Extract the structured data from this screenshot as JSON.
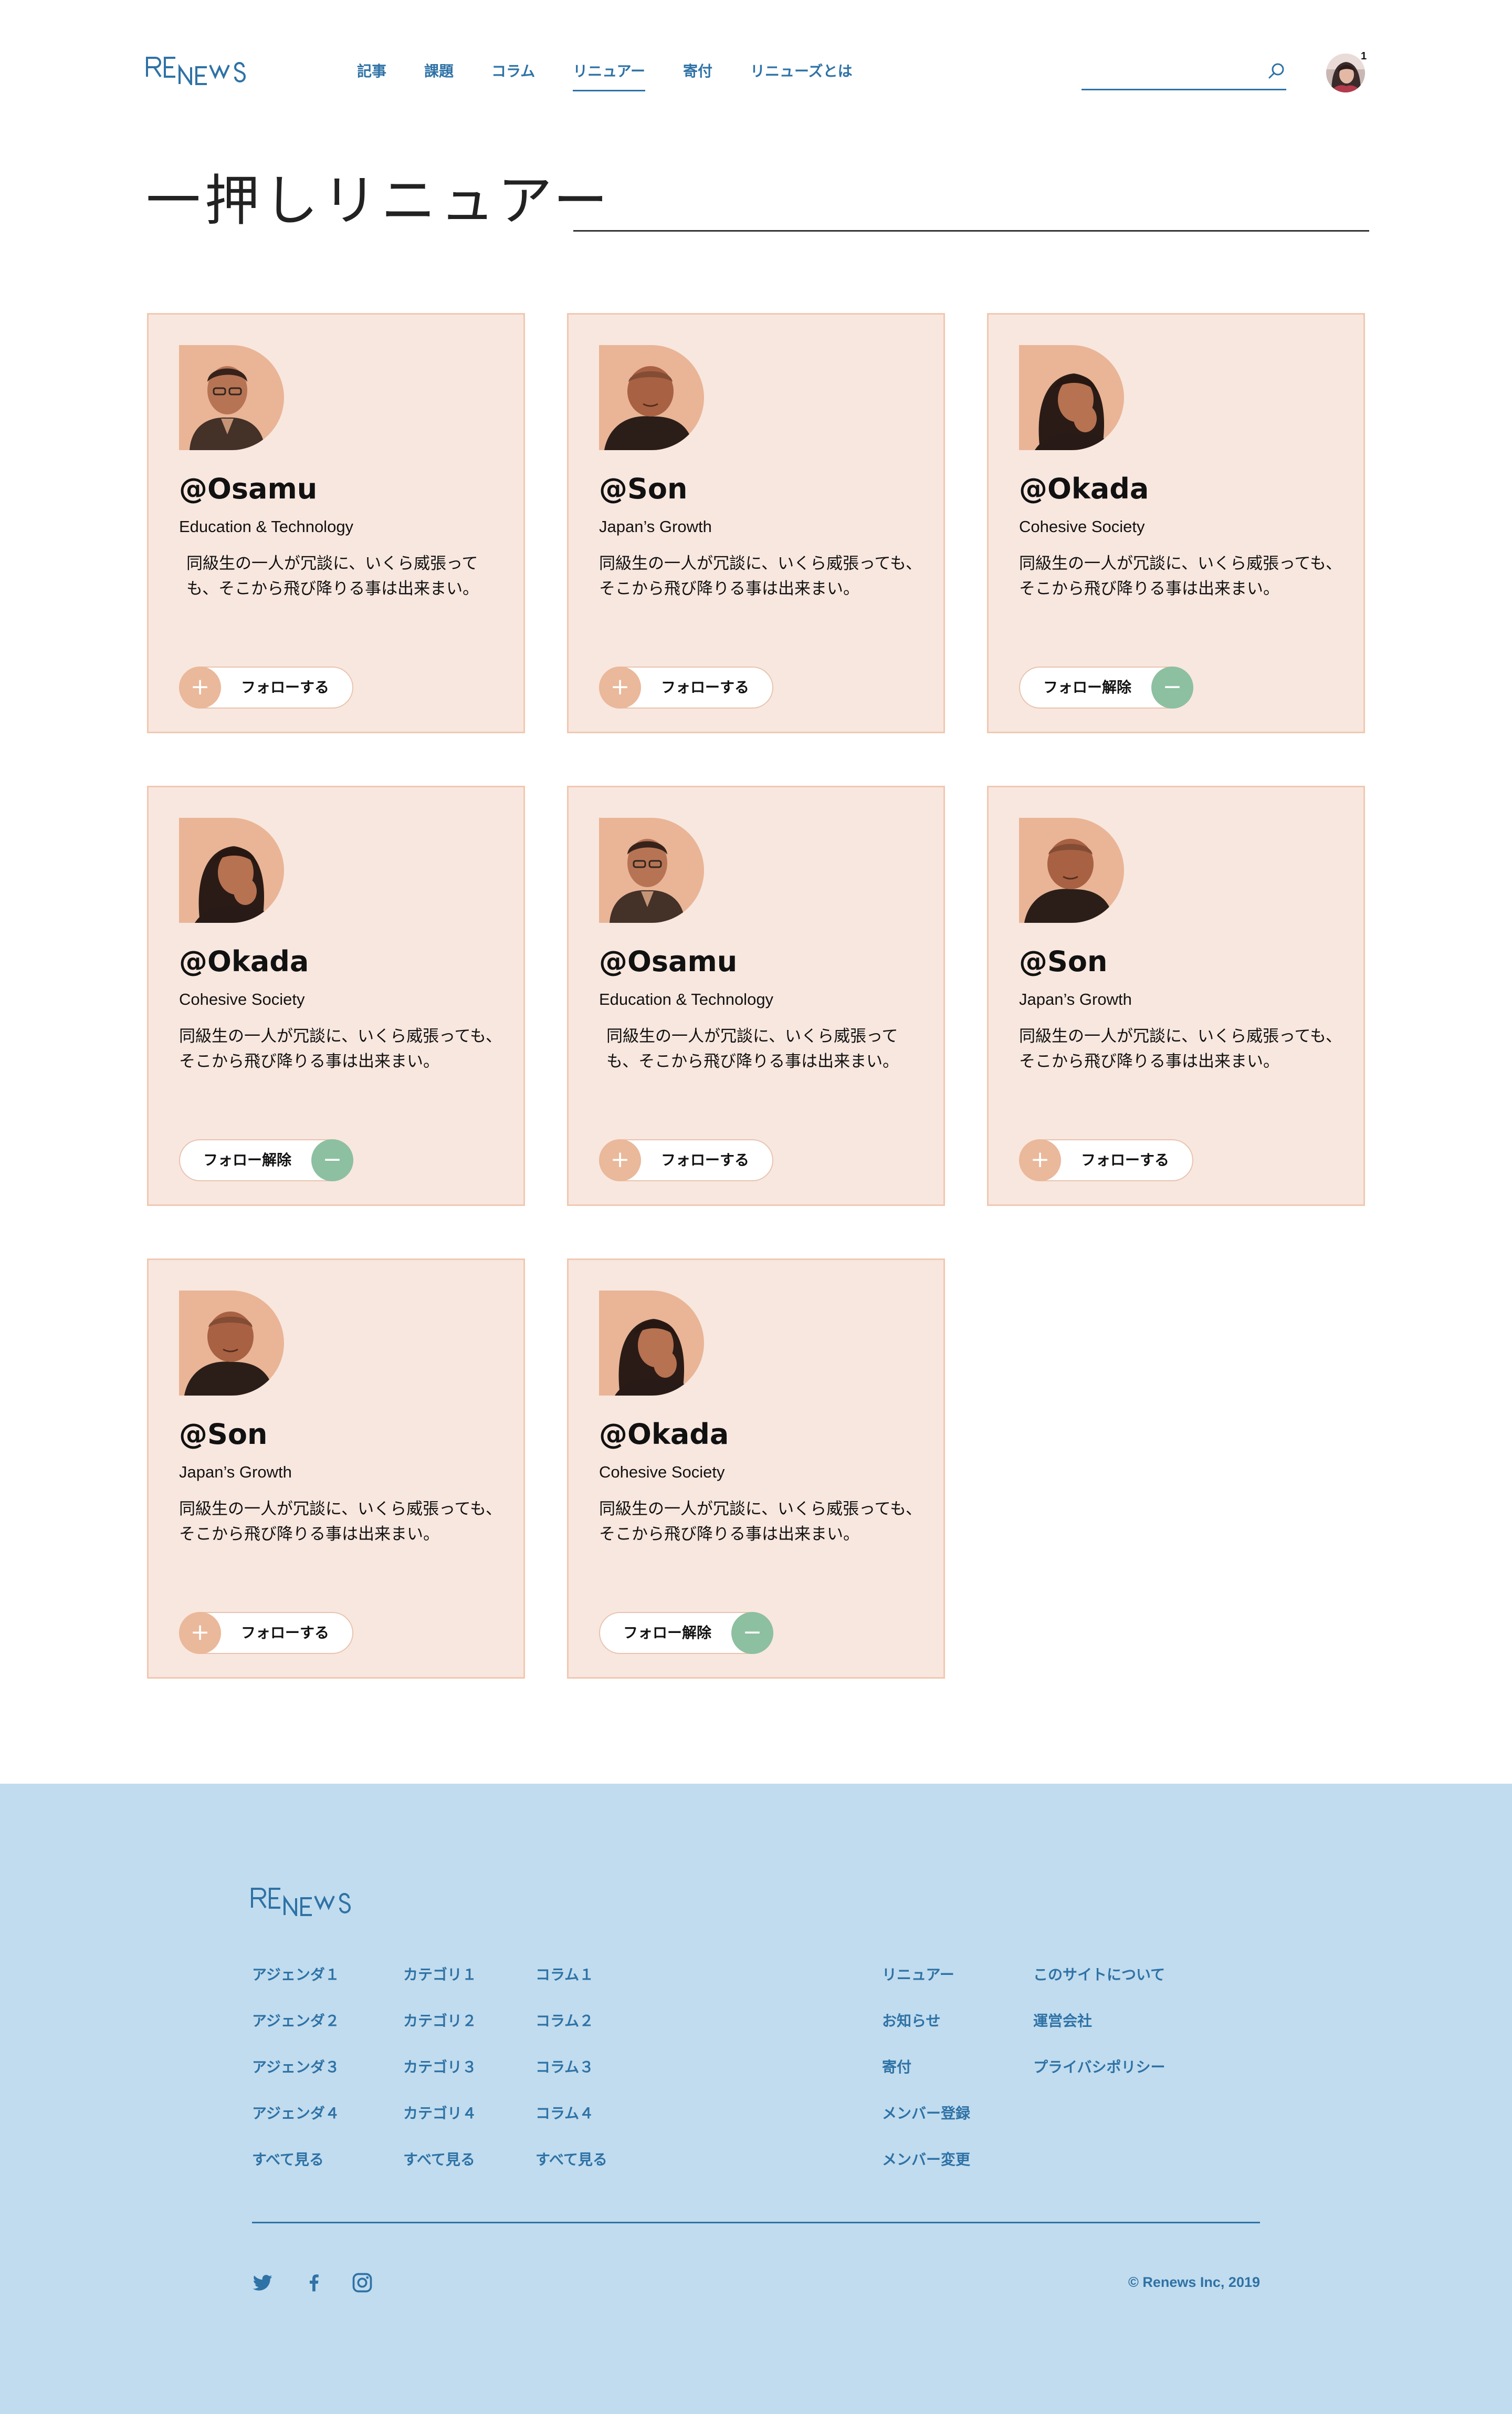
{
  "brand": {
    "logo_text": "RENEWS",
    "color": "#2e72a6"
  },
  "nav": {
    "items": [
      {
        "label": "記事",
        "active": false
      },
      {
        "label": "課題",
        "active": false
      },
      {
        "label": "コラム",
        "active": false
      },
      {
        "label": "リニュアー",
        "active": true
      },
      {
        "label": "寄付",
        "active": false
      },
      {
        "label": "リニューズとは",
        "active": false
      }
    ]
  },
  "search": {
    "value": "",
    "placeholder": "",
    "icon": "search-icon"
  },
  "user": {
    "notification_count": "1"
  },
  "page_title": "一押しリニュアー",
  "colors": {
    "card_bg": "#f8e7df",
    "card_border": "#f1c8b1",
    "follow_accent": "#eab89a",
    "unfollow_accent": "#8cc0a0",
    "footer_bg": "#c1dcee"
  },
  "cards": [
    {
      "handle": "@Osamu",
      "category": "Education & Technology",
      "description": "同級生の一人が冗談に、いくら威張っても、そこから飛び降りる事は出来まい。",
      "button_label": "フォローする",
      "state": "follow",
      "button_icon": "plus-icon",
      "person": "osamu"
    },
    {
      "handle": "@Son",
      "category": "Japan’s Growth",
      "description": "同級生の一人が冗談に、いくら威張っても、そこから飛び降りる事は出来まい。",
      "button_label": "フォローする",
      "state": "follow",
      "button_icon": "plus-icon",
      "person": "son"
    },
    {
      "handle": "@Okada",
      "category": "Cohesive Society",
      "description": "同級生の一人が冗談に、いくら威張っても、そこから飛び降りる事は出来まい。",
      "button_label": "フォロー解除",
      "state": "unfollow",
      "button_icon": "minus-icon",
      "person": "okada"
    },
    {
      "handle": "@Okada",
      "category": "Cohesive Society",
      "description": "同級生の一人が冗談に、いくら威張っても、そこから飛び降りる事は出来まい。",
      "button_label": "フォロー解除",
      "state": "unfollow",
      "button_icon": "minus-icon",
      "person": "okada"
    },
    {
      "handle": "@Osamu",
      "category": "Education & Technology",
      "description": "同級生の一人が冗談に、いくら威張っても、そこから飛び降りる事は出来まい。",
      "button_label": "フォローする",
      "state": "follow",
      "button_icon": "plus-icon",
      "person": "osamu"
    },
    {
      "handle": "@Son",
      "category": "Japan’s Growth",
      "description": "同級生の一人が冗談に、いくら威張っても、そこから飛び降りる事は出来まい。",
      "button_label": "フォローする",
      "state": "follow",
      "button_icon": "plus-icon",
      "person": "son"
    },
    {
      "handle": "@Son",
      "category": "Japan’s Growth",
      "description": "同級生の一人が冗談に、いくら威張っても、そこから飛び降りる事は出来まい。",
      "button_label": "フォローする",
      "state": "follow",
      "button_icon": "plus-icon",
      "person": "son"
    },
    {
      "handle": "@Okada",
      "category": "Cohesive Society",
      "description": "同級生の一人が冗談に、いくら威張っても、そこから飛び降りる事は出来まい。",
      "button_label": "フォロー解除",
      "state": "unfollow",
      "button_icon": "minus-icon",
      "person": "okada"
    }
  ],
  "footer": {
    "columns": [
      {
        "links": [
          "アジェンダ１",
          "アジェンダ２",
          "アジェンダ３",
          "アジェンダ４",
          "すべて見る"
        ]
      },
      {
        "links": [
          "カテゴリ１",
          "カテゴリ２",
          "カテゴリ３",
          "カテゴリ４",
          "すべて見る"
        ]
      },
      {
        "links": [
          "コラム１",
          "コラム２",
          "コラム３",
          "コラム４",
          "すべて見る"
        ]
      },
      {
        "links": [
          "リニュアー",
          "お知らせ",
          "寄付",
          "メンバー登録",
          "メンバー変更"
        ]
      },
      {
        "links": [
          "このサイトについて",
          "運営会社",
          "プライバシポリシー"
        ]
      }
    ],
    "social": [
      "twitter-icon",
      "facebook-icon",
      "instagram-icon"
    ],
    "copyright": "© Renews Inc, 2019"
  }
}
